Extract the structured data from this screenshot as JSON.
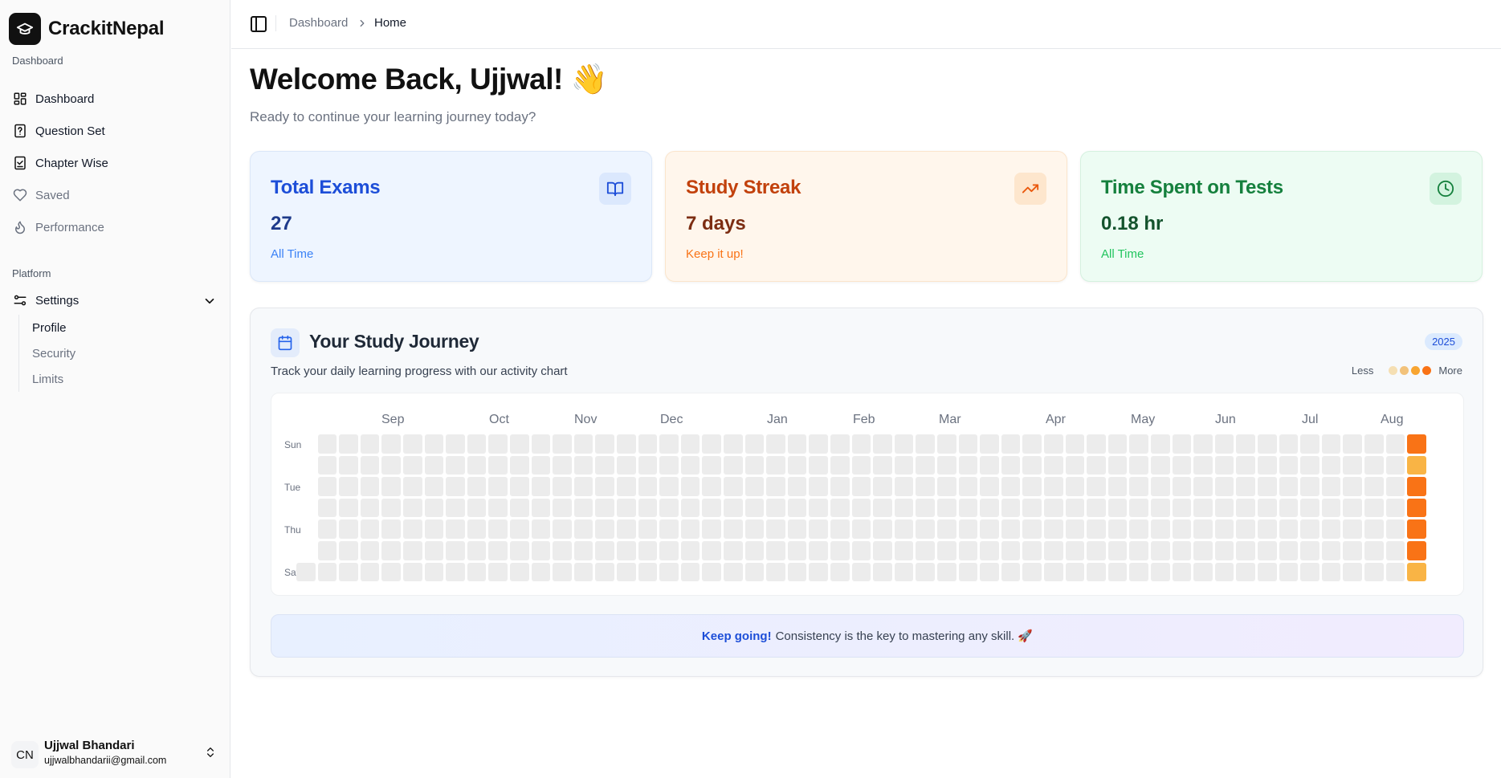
{
  "brand": {
    "name": "CrackitNepal"
  },
  "sidebar": {
    "dashboard_group": "Dashboard",
    "items": [
      {
        "label": "Dashboard",
        "icon": "layout-dashboard-icon"
      },
      {
        "label": "Question Set",
        "icon": "file-question-icon"
      },
      {
        "label": "Chapter Wise",
        "icon": "file-check-icon"
      },
      {
        "label": "Saved",
        "icon": "heart-icon"
      },
      {
        "label": "Performance",
        "icon": "flame-icon"
      }
    ],
    "platform_group": "Platform",
    "settings": {
      "label": "Settings",
      "expanded": true,
      "sub_items": [
        "Profile",
        "Security",
        "Limits"
      ],
      "active": "Profile"
    }
  },
  "user": {
    "initials": "CN",
    "name": "Ujjwal Bhandari",
    "email": "ujjwalbhandarii@gmail.com"
  },
  "header": {
    "breadcrumb": [
      "Dashboard",
      "Home"
    ]
  },
  "welcome": {
    "title": "Welcome Back, Ujjwal! 👋",
    "subtitle": "Ready to continue your learning journey today?"
  },
  "cards": [
    {
      "title": "Total Exams",
      "value": "27",
      "caption": "All Time",
      "icon": "book-open-icon",
      "color": "#1d4ed8"
    },
    {
      "title": "Study Streak",
      "value": "7 days",
      "caption": "Keep it up!",
      "icon": "trending-up-icon",
      "color": "#ea580c"
    },
    {
      "title": "Time Spent on Tests",
      "value": "0.18 hr",
      "caption": "All Time",
      "icon": "clock-icon",
      "color": "#15803d"
    }
  ],
  "journey": {
    "title": "Your Study Journey",
    "subtitle": "Track your daily learning progress with our activity chart",
    "year": "2025",
    "legend_less": "Less",
    "legend_more": "More",
    "legend_colors": [
      "#f5dfb3",
      "#f2c27a",
      "#f8a531",
      "#f97316"
    ],
    "months": [
      "Sep",
      "Oct",
      "Nov",
      "Dec",
      "Jan",
      "Feb",
      "Mar",
      "Apr",
      "May",
      "Jun",
      "Jul",
      "Aug"
    ],
    "day_labels": [
      "Sun",
      "Tue",
      "Thu",
      "Sat"
    ],
    "weeks": 52,
    "activity_last_week": [
      4,
      3,
      4,
      4,
      4,
      4,
      3
    ],
    "activity_colors": {
      "0": "#ececec",
      "3": "#f9b445",
      "4": "#f97316"
    },
    "encourage_strong": "Keep going!",
    "encourage_text": "Consistency is the key to mastering any skill. 🚀"
  }
}
